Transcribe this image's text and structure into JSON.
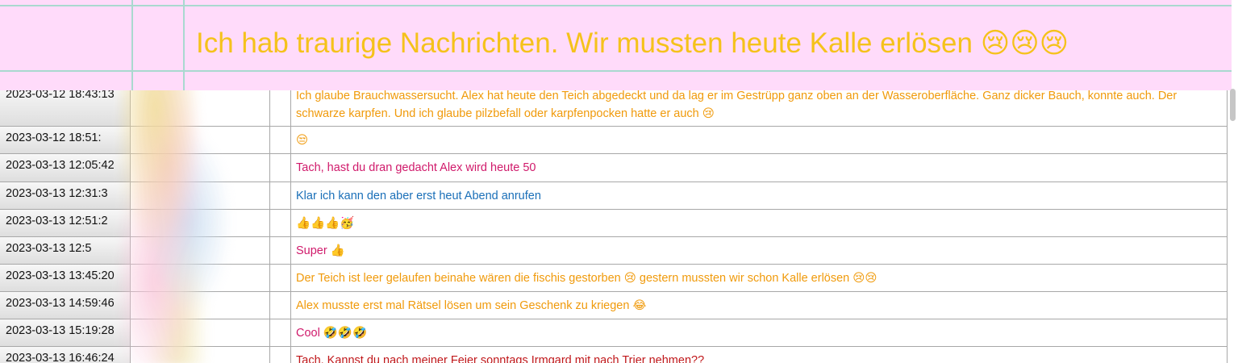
{
  "banner": {
    "text": "Ich hab traurige Nachrichten. Wir mussten heute Kalle erlösen 😢😢😢"
  },
  "rows": [
    {
      "date": "2023-03-12 18:43:13",
      "text": "Ich glaube Brauchwassersucht. Alex hat heute den Teich abgedeckt und da lag er im Gestrüpp ganz oben an der Wasseroberfläche. Ganz dicker Bauch, konnte auch. Der schwarze karpfen. Und ich glaube pilzbefall oder karpfenpocken hatte er auch 😢",
      "color": "#f09a0b"
    },
    {
      "date": "2023-03-12 18:51:",
      "text": "😒",
      "color": "#f09a0b"
    },
    {
      "date": "2023-03-13 12:05:42",
      "text": "Tach, hast du dran gedacht Alex wird heute 50",
      "color": "#d01a6b"
    },
    {
      "date": "2023-03-13 12:31:3",
      "text": "Klar ich kann den aber erst heut Abend anrufen",
      "color": "#1a6fb8"
    },
    {
      "date": "2023-03-13 12:51:2",
      "text": "👍👍👍🥳",
      "color": "#f09a0b"
    },
    {
      "date": "2023-03-13 12:5",
      "text": "Super 👍",
      "color": "#d01a6b"
    },
    {
      "date": "2023-03-13 13:45:20",
      "text": "Der Teich ist leer gelaufen beinahe wären die fischis gestorben 😢 gestern mussten wir schon Kalle erlösen 😢😢",
      "color": "#f09a0b"
    },
    {
      "date": "2023-03-13 14:59:46",
      "text": "Alex musste erst mal Rätsel lösen um sein Geschenk zu kriegen 😂",
      "color": "#f09a0b"
    },
    {
      "date": "2023-03-13 15:19:28",
      "text": "Cool 🤣🤣🤣",
      "color": "#d01a6b"
    },
    {
      "date": "2023-03-13 16:46:24",
      "text": "Tach. Kannst du nach meiner Feier sonntags Irmgard mit nach Trier nehmen??",
      "color": "#c0181b"
    }
  ]
}
